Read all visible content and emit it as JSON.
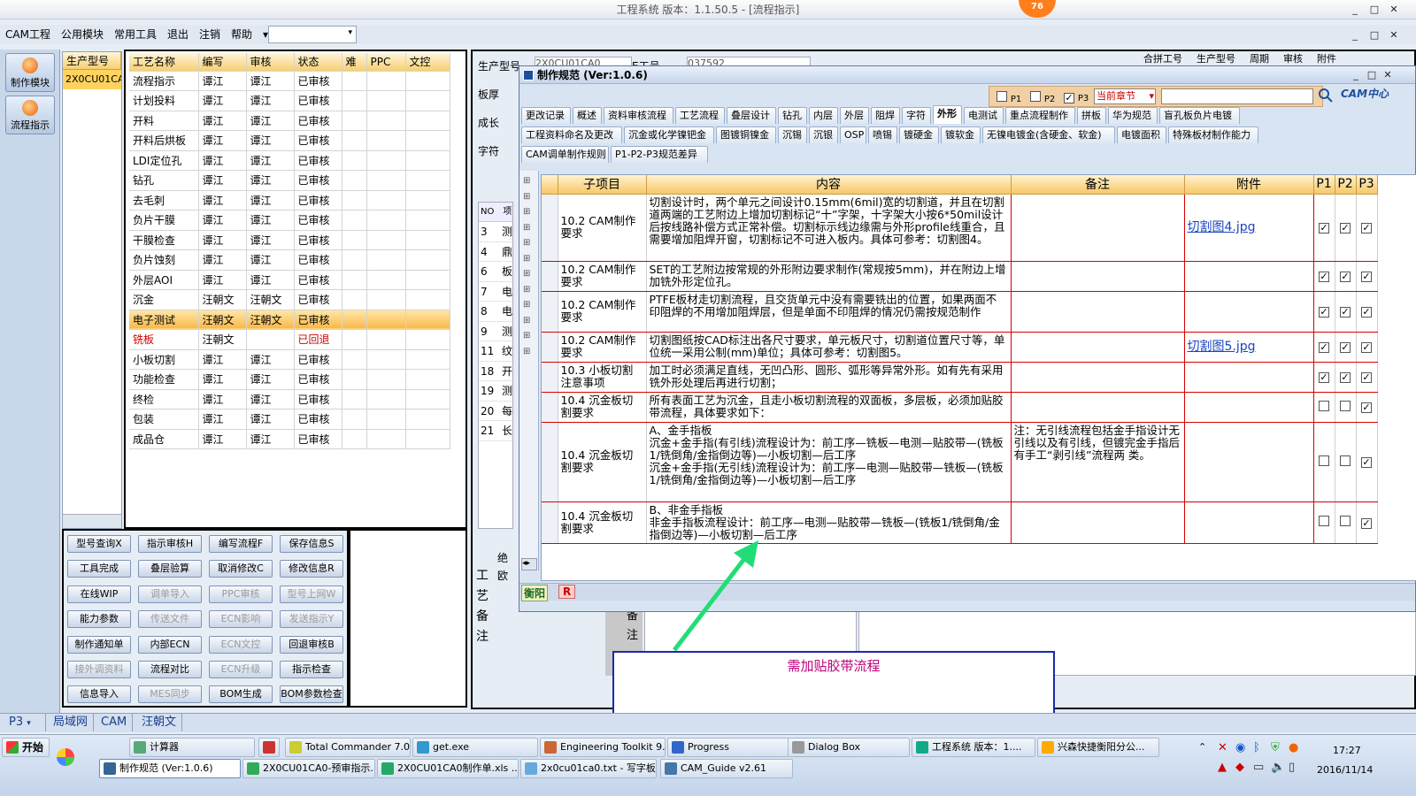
{
  "window": {
    "title": "工程系统  版本：1.1.50.5 - [流程指示]",
    "badge": "76",
    "btn_min": "_",
    "btn_max": "□",
    "btn_close": "✕"
  },
  "menu": {
    "items": [
      "CAM工程",
      "公用模块",
      "常用工具",
      "退出",
      "注销",
      "帮助"
    ],
    "dropdown_arrow": "▾"
  },
  "sidebar": {
    "make": "制作模块",
    "flow": "流程指示"
  },
  "model": {
    "header": "生产型号",
    "value": "2X0CU01CA"
  },
  "process_grid": {
    "headers": [
      "工艺名称",
      "编写",
      "审核",
      "状态",
      "难",
      "PPC",
      "文控"
    ],
    "rows": [
      [
        "流程指示",
        "谭江",
        "谭江",
        "已审核"
      ],
      [
        "计划投料",
        "谭江",
        "谭江",
        "已审核"
      ],
      [
        "开料",
        "谭江",
        "谭江",
        "已审核"
      ],
      [
        "开料后烘板",
        "谭江",
        "谭江",
        "已审核"
      ],
      [
        "LDI定位孔",
        "谭江",
        "谭江",
        "已审核"
      ],
      [
        "钻孔",
        "谭江",
        "谭江",
        "已审核"
      ],
      [
        "去毛刺",
        "谭江",
        "谭江",
        "已审核"
      ],
      [
        "负片干膜",
        "谭江",
        "谭江",
        "已审核"
      ],
      [
        "干膜检查",
        "谭江",
        "谭江",
        "已审核"
      ],
      [
        "负片蚀刻",
        "谭江",
        "谭江",
        "已审核"
      ],
      [
        "外层AOI",
        "谭江",
        "谭江",
        "已审核"
      ],
      [
        "沉金",
        "汪朝文",
        "汪朝文",
        "已审核"
      ],
      [
        "电子测试",
        "汪朝文",
        "汪朝文",
        "已审核"
      ],
      [
        "铣板",
        "汪朝文",
        "",
        "已回退"
      ],
      [
        "小板切割",
        "谭江",
        "谭江",
        "已审核"
      ],
      [
        "功能检查",
        "谭江",
        "谭江",
        "已审核"
      ],
      [
        "终检",
        "谭江",
        "谭江",
        "已审核"
      ],
      [
        "包装",
        "谭江",
        "谭江",
        "已审核"
      ],
      [
        "成品仓",
        "谭江",
        "谭江",
        "已审核"
      ]
    ]
  },
  "buttons": [
    [
      "型号查询X",
      "指示审核H",
      "编写流程F",
      "保存信息S"
    ],
    [
      "工具完成",
      "叠层验算",
      "取消修改C",
      "修改信息R"
    ],
    [
      "在线WIP",
      "调单导入",
      "PPC审核",
      "型号上网W"
    ],
    [
      "能力参数",
      "传送文件",
      "ECN影响",
      "发送指示Y"
    ],
    [
      "制作通知单",
      "内部ECN",
      "ECN文控",
      "回退审核B"
    ],
    [
      "接外调资料",
      "流程对比",
      "ECN升级",
      "指示检查"
    ],
    [
      "信息导入",
      "MES同步",
      "BOM生成",
      "BOM参数检查"
    ]
  ],
  "right_bg": {
    "labels": [
      "生产型号",
      "板厚",
      "成长",
      "字符"
    ],
    "model_val": "2X0CU01CA0",
    "etype_label": "E工号",
    "etype_val": "037592",
    "tabs": [
      "合拼工号",
      "生产型号",
      "周期",
      "审核",
      "附件"
    ],
    "no_header": [
      "NO",
      "项"
    ],
    "nos": [
      "3",
      "4",
      "6",
      "7",
      "8",
      "9",
      "11",
      "18",
      "19",
      "20",
      "21"
    ],
    "marks": [
      "测",
      "鼎",
      "板",
      "电",
      "电",
      "测",
      "纹",
      "开",
      "测",
      "每",
      "长"
    ],
    "craft_note": "工艺备注",
    "note": "备注",
    "absolute": "绝",
    "europe": "欧"
  },
  "dialog": {
    "title": "制作规范 (Ver:1.0.6)",
    "filters": [
      "P1",
      "P2",
      "P3"
    ],
    "chapter": "当前章节",
    "logo": "CAM中心",
    "tabs_row1": [
      "更改记录",
      "概述",
      "资料审核流程",
      "工艺流程",
      "叠层设计",
      "钻孔",
      "内层",
      "外层",
      "阻焊",
      "字符",
      "外形",
      "电测试",
      "重点流程制作",
      "拼板",
      "华为规范",
      "盲孔板负片电镀"
    ],
    "tabs_row2": [
      "工程资料命名及更改",
      "沉金或化学镍钯金",
      "图镀铜镍金",
      "沉锡",
      "沉银",
      "OSP",
      "喷锡",
      "镀硬金",
      "镀软金",
      "无镍电镀金(含硬金、软金)",
      "电镀面积",
      "特殊板材制作能力"
    ],
    "tabs_row3": [
      "CAM调单制作规则",
      "P1-P2-P3规范差异"
    ],
    "active_tab": "外形",
    "columns": [
      "子项目",
      "内容",
      "备注",
      "附件",
      "P1",
      "P2",
      "P3"
    ],
    "rows": [
      {
        "sub": "10.2 CAM制作要求",
        "content": "切割设计时，两个单元之间设计0.15mm(6mil)宽的切割道，并且在切割道两端的工艺附边上增加切割标记“十”字架，十字架大小按6*50mil设计后按线路补偿方式正常补偿。切割标示线边缘需与外形profile线重合，且需要增加阻焊开窗，切割标记不可进入板内。具体可参考：切割图4。",
        "note": "",
        "attach": "切割图4.jpg",
        "p": [
          true,
          true,
          true
        ]
      },
      {
        "sub": "10.2 CAM制作要求",
        "content": "SET的工艺附边按常规的外形附边要求制作(常规按5mm)，并在附边上增加铣外形定位孔。",
        "note": "",
        "attach": "",
        "p": [
          true,
          true,
          true
        ]
      },
      {
        "sub": "10.2 CAM制作要求",
        "content": "PTFE板材走切割流程，且交货单元中没有需要铣出的位置，如果两面不印阻焊的不用增加阻焊层，但是单面不印阻焊的情况仍需按规范制作",
        "note": "",
        "attach": "",
        "p": [
          true,
          true,
          true
        ]
      },
      {
        "sub": "10.2 CAM制作要求",
        "content": "切割图纸按CAD标注出各尺寸要求，单元板尺寸，切割道位置尺寸等，单位统一采用公制(mm)单位；具体可参考：切割图5。",
        "note": "",
        "attach": "切割图5.jpg",
        "p": [
          true,
          true,
          true
        ]
      },
      {
        "sub": "10.3 小板切割注意事项",
        "content": "加工时必须满足直线，无凹凸形、圆形、弧形等异常外形。如有先有采用铣外形处理后再进行切割；",
        "note": "",
        "attach": "",
        "p": [
          true,
          true,
          true
        ]
      },
      {
        "sub": "10.4 沉金板切割要求",
        "content": "所有表面工艺为沉金，且走小板切割流程的双面板，多层板，必须加贴胶带流程，具体要求如下：",
        "note": "",
        "attach": "",
        "p": [
          false,
          false,
          true
        ]
      },
      {
        "sub": "10.4 沉金板切割要求",
        "content": "A、金手指板\n沉金+金手指(有引线)流程设计为：前工序—铣板—电测—贴胶带—(铣板1/铣倒角/金指倒边等)—小板切割—后工序\n沉金+金手指(无引线)流程设计为：前工序—电测—贴胶带—铣板—(铣板1/铣倒角/金指倒边等)—小板切割—后工序",
        "note": "注：无引线流程包括金手指设计无引线以及有引线，但镀完金手指后有手工“剥引线”流程两 类。",
        "attach": "",
        "p": [
          false,
          false,
          true
        ]
      },
      {
        "sub": "10.4 沉金板切割要求",
        "content": "B、非金手指板\n非金手指板流程设计：前工序—电测—贴胶带—铣板—(铣板1/铣倒角/金指倒边等)—小板切割—后工序",
        "note": "",
        "attach": "",
        "p": [
          false,
          false,
          true
        ]
      }
    ],
    "footer": [
      "衡阳",
      "R"
    ]
  },
  "callout": {
    "text": "需加贴胶带流程"
  },
  "status_tabs": [
    "P3",
    "局域网",
    "CAM",
    "汪朝文"
  ],
  "taskbar": {
    "start": "开始",
    "row1": [
      "计算器",
      "",
      "Total Commander 7.0...",
      "get.exe",
      "Engineering Toolkit 9....",
      "Progress",
      "Dialog Box",
      "工程系统  版本：1....",
      "兴森快捷衡阳分公..."
    ],
    "row2": [
      "制作规范 (Ver:1.0.6)",
      "2X0CU01CA0-预审指示...",
      "2X0CU01CA0制作单.xls ...",
      "2x0cu01ca0.txt - 写字板",
      "CAM_Guide v2.61"
    ],
    "time": "17:27",
    "date": "2016/11/14"
  },
  "colors": {
    "accent": "#f8c865",
    "link": "#1a45c0",
    "annot": "#1a2aa8",
    "callout_text": "#c0007c",
    "arrow": "#22dd77"
  }
}
